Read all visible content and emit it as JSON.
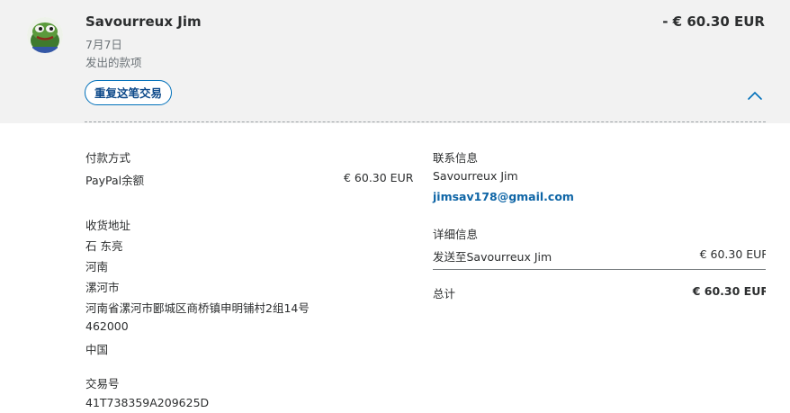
{
  "transaction": {
    "merchant_name": "Savourreux Jim",
    "date": "7月7日",
    "type": "发出的款项",
    "amount": "- € 60.30 EUR",
    "repeat_button_label": "重复这笔交易"
  },
  "payment_method": {
    "heading": "付款方式",
    "source": "PayPal余额",
    "amount": "€ 60.30 EUR"
  },
  "shipping_address": {
    "heading": "收货地址",
    "lines": [
      "石 东亮",
      "河南",
      "漯河市",
      "河南省漯河市郾城区商桥镇申明铺村2组14号",
      "462000",
      "中国"
    ]
  },
  "transaction_id": {
    "heading": "交易号",
    "value": "41T738359A209625D"
  },
  "contact": {
    "heading": "联系信息",
    "name": "Savourreux Jim",
    "email": "jimsav178@gmail.com"
  },
  "details": {
    "heading": "详细信息",
    "sent_to_label": "发送至Savourreux Jim",
    "sent_to_amount": "€ 60.30 EUR",
    "total_label": "总计",
    "total_amount": "€ 60.30 EUR"
  },
  "colors": {
    "header_bg": "#f2f2f2",
    "link_blue": "#0e65a6",
    "button_border": "#0070ba"
  },
  "icons": {
    "avatar": "frog-avatar",
    "collapse": "chevron-up-icon"
  }
}
